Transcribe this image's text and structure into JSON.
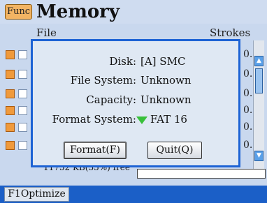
{
  "header": {
    "func_label": "Func",
    "title": "Memory"
  },
  "columns": {
    "file": "File",
    "strokes": "Strokes"
  },
  "rows": [
    {
      "strokes": "0."
    },
    {
      "strokes": "0."
    },
    {
      "strokes": "0."
    },
    {
      "strokes": "0."
    },
    {
      "strokes": "0."
    },
    {
      "strokes": "0."
    }
  ],
  "free_space": {
    "text": "11752 KB(35%) free"
  },
  "bottom": {
    "f1_label": "F1Optimize"
  },
  "dialog": {
    "disk_label": "Disk:",
    "disk_value": "[A] SMC",
    "filesystem_label": "File System:",
    "filesystem_value": "Unknown",
    "capacity_label": "Capacity:",
    "capacity_value": "Unknown",
    "format_label": "Format System:",
    "format_value": "FAT 16",
    "format_button": "Format(F)",
    "quit_button": "Quit(Q)"
  },
  "colors": {
    "accent": "#1d63d4",
    "bottom_bar": "#1b5fc7",
    "orange": "#f09a3c",
    "green_triangle": "#38c03a"
  }
}
